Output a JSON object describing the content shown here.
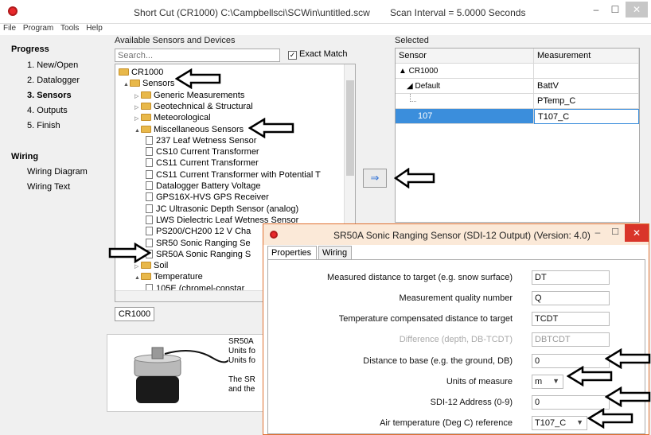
{
  "window": {
    "title": "Short Cut (CR1000) C:\\Campbellsci\\SCWin\\untitled.scw",
    "scan_interval": "Scan Interval = 5.0000 Seconds"
  },
  "menu": [
    "File",
    "Program",
    "Tools",
    "Help"
  ],
  "nav": {
    "progress_heading": "Progress",
    "progress_items": [
      "1. New/Open",
      "2. Datalogger",
      "3. Sensors",
      "4. Outputs",
      "5. Finish"
    ],
    "active_index": 2,
    "wiring_heading": "Wiring",
    "wiring_items": [
      "Wiring Diagram",
      "Wiring Text"
    ]
  },
  "available": {
    "label": "Available Sensors and Devices",
    "search_placeholder": "Search...",
    "exact_match_label": "Exact Match",
    "exact_match_checked": true,
    "tree": [
      {
        "label": "CR1000",
        "type": "folder",
        "level": 0,
        "expander": ""
      },
      {
        "label": "Sensors",
        "type": "folder",
        "level": 1,
        "expander": "▲"
      },
      {
        "label": "Generic Measurements",
        "type": "folder",
        "level": 2,
        "expander": "▷"
      },
      {
        "label": "Geotechnical & Structural",
        "type": "folder",
        "level": 2,
        "expander": "▷"
      },
      {
        "label": "Meteorological",
        "type": "folder",
        "level": 2,
        "expander": "▷"
      },
      {
        "label": "Miscellaneous Sensors",
        "type": "folder",
        "level": 2,
        "expander": "▲"
      },
      {
        "label": "237 Leaf Wetness Sensor",
        "type": "doc",
        "level": 3
      },
      {
        "label": "CS10 Current Transformer",
        "type": "doc",
        "level": 3
      },
      {
        "label": "CS11 Current Transformer",
        "type": "doc",
        "level": 3
      },
      {
        "label": "CS11 Current Transformer with Potential T",
        "type": "doc",
        "level": 3
      },
      {
        "label": "Datalogger Battery Voltage",
        "type": "doc",
        "level": 3
      },
      {
        "label": "GPS16X-HVS GPS Receiver",
        "type": "doc",
        "level": 3
      },
      {
        "label": "JC Ultrasonic Depth Sensor (analog)",
        "type": "doc",
        "level": 3
      },
      {
        "label": "LWS Dielectric Leaf Wetness Sensor",
        "type": "doc",
        "level": 3
      },
      {
        "label": "PS200/CH200 12 V Cha",
        "type": "doc",
        "level": 3
      },
      {
        "label": "SR50 Sonic Ranging Se",
        "type": "doc",
        "level": 3
      },
      {
        "label": "SR50A Sonic Ranging S",
        "type": "doc",
        "level": 3
      },
      {
        "label": "Soil",
        "type": "folder",
        "level": 2,
        "expander": "▷"
      },
      {
        "label": "Temperature",
        "type": "folder",
        "level": 2,
        "expander": "▲"
      },
      {
        "label": "105E (chromel-constar",
        "type": "doc",
        "level": 3
      }
    ],
    "tab_label": "CR1000",
    "description_lines": [
      "SR50A",
      "Units fo",
      "Units fo",
      "",
      "The SR",
      "and the"
    ]
  },
  "selected": {
    "label": "Selected",
    "columns": [
      "Sensor",
      "Measurement"
    ],
    "rows": [
      {
        "sensor": "▲ CR1000",
        "measurement": ""
      },
      {
        "sensor": "◢ Default",
        "measurement": "BattV"
      },
      {
        "sensor": "",
        "measurement": "PTemp_C"
      },
      {
        "sensor": "107",
        "measurement": "T107_C"
      }
    ]
  },
  "add_button_symbol": "⇒",
  "dialog": {
    "title": "SR50A Sonic Ranging Sensor (SDI-12 Output) (Version: 4.0)",
    "tabs": [
      "Properties",
      "Wiring"
    ],
    "fields": [
      {
        "label": "Measured distance to target (e.g. snow surface)",
        "value": "DT"
      },
      {
        "label": "Measurement quality number",
        "value": "Q"
      },
      {
        "label": "Temperature compensated distance to target",
        "value": "TCDT"
      },
      {
        "label": "Difference (depth, DB-TCDT)",
        "value": "DBTCDT"
      },
      {
        "label": "Distance to base (e.g. the ground, DB)",
        "value": "0"
      },
      {
        "label": "Units of measure",
        "value": "m"
      },
      {
        "label": "SDI-12 Address (0-9)",
        "value": "0"
      },
      {
        "label": "Air temperature (Deg C) reference",
        "value": "T107_C"
      }
    ]
  },
  "colors": {
    "selection": "#3b8edc",
    "folder": "#e8b84a",
    "dialog_title_bg": "#fbe9d8",
    "close_red": "#d9352a"
  }
}
